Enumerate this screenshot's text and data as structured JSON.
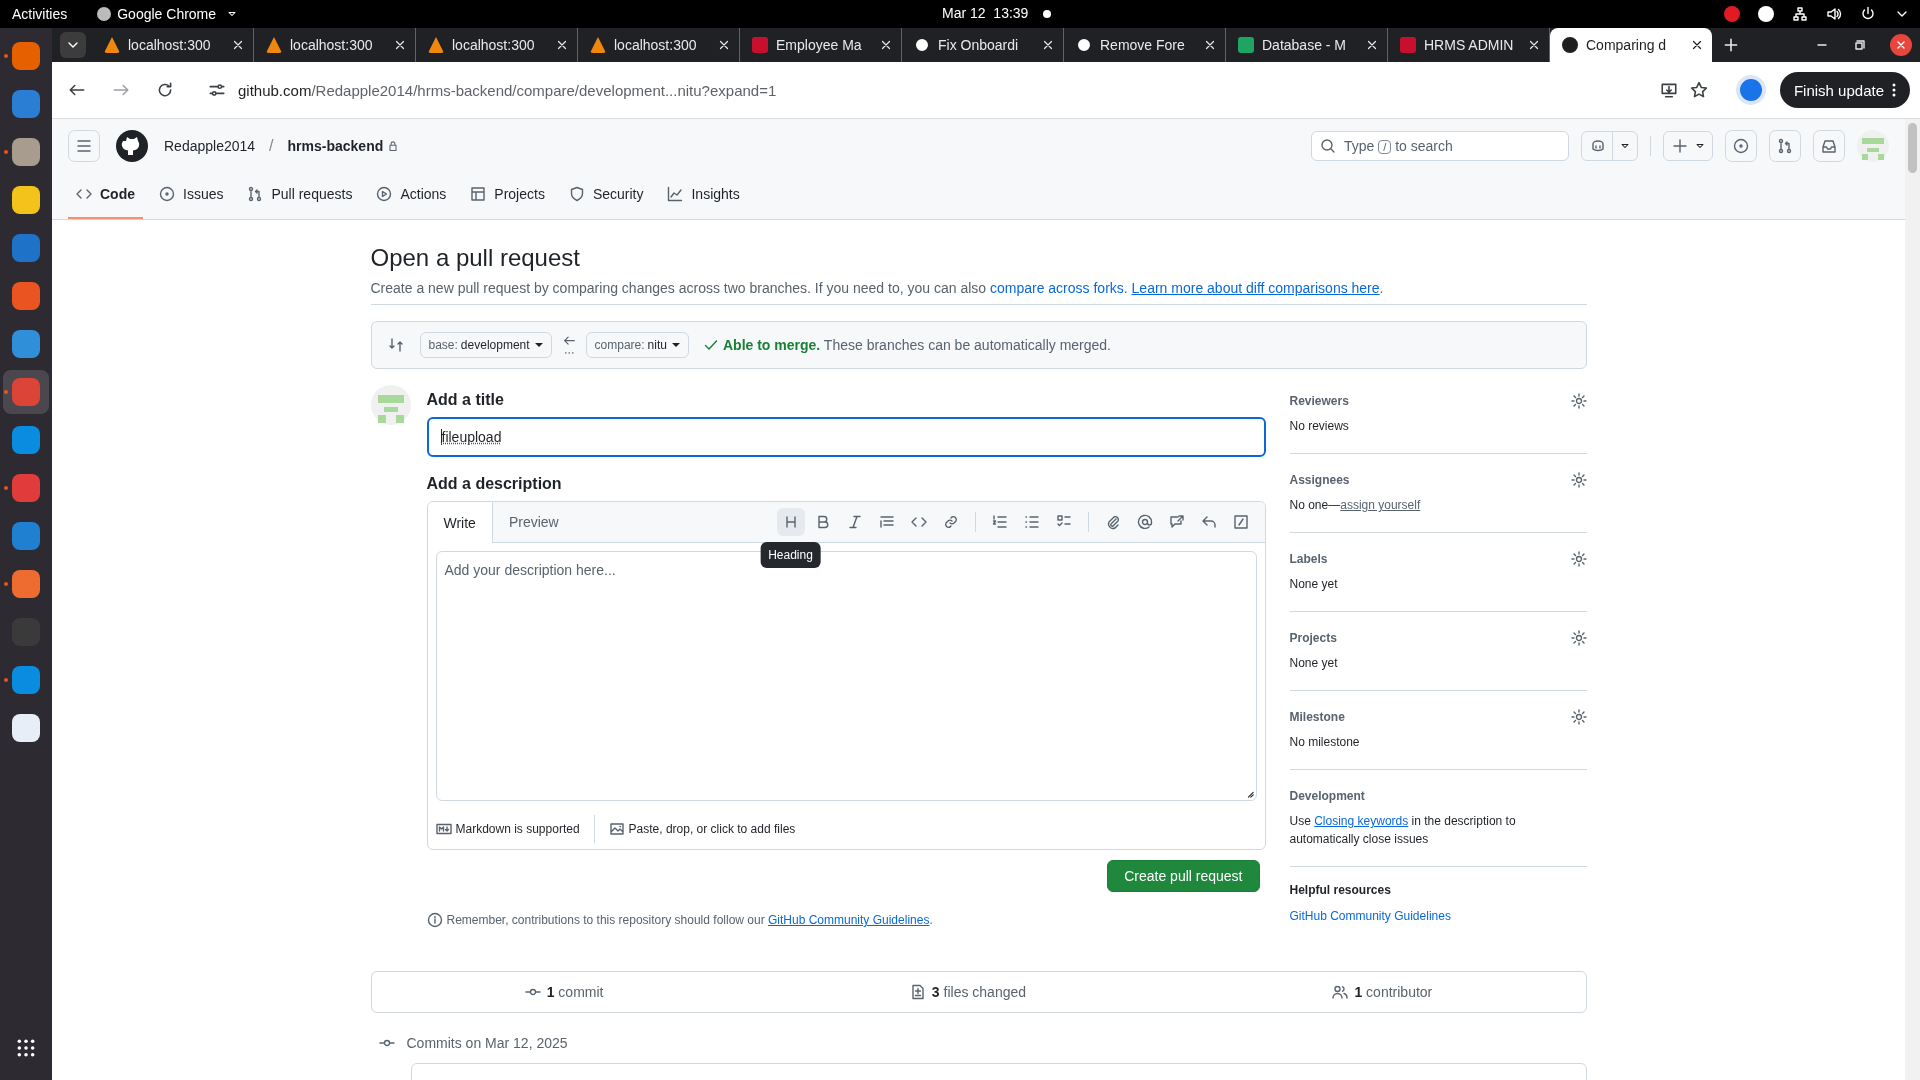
{
  "system_bar": {
    "activities": "Activities",
    "app_name": "Google Chrome",
    "clock": "Mar 12  13:39"
  },
  "dock": [
    {
      "kind": "fox",
      "running": true,
      "selected": false
    },
    {
      "kind": "bird",
      "running": false,
      "selected": false
    },
    {
      "kind": "folder",
      "running": true,
      "selected": false
    },
    {
      "kind": "speaker",
      "running": false,
      "selected": false
    },
    {
      "kind": "document",
      "running": false,
      "selected": false
    },
    {
      "kind": "store",
      "running": false,
      "selected": false
    },
    {
      "kind": "help",
      "running": false,
      "selected": false
    },
    {
      "kind": "wheel",
      "running": true,
      "selected": true
    },
    {
      "kind": "chat",
      "running": false,
      "selected": false
    },
    {
      "kind": "apple",
      "running": true,
      "selected": false
    },
    {
      "kind": "code",
      "running": false,
      "selected": false
    },
    {
      "kind": "rocket",
      "running": true,
      "selected": false
    },
    {
      "kind": "terminal",
      "running": false,
      "selected": false
    },
    {
      "kind": "chat",
      "running": true,
      "selected": false
    },
    {
      "kind": "pencil",
      "running": false,
      "selected": false
    },
    {
      "kind": "grid",
      "running": false,
      "selected": false
    }
  ],
  "browser_tabs": [
    {
      "title": "localhost:300",
      "kind": "triangle",
      "selected": false
    },
    {
      "title": "localhost:300",
      "kind": "triangle",
      "selected": false
    },
    {
      "title": "localhost:300",
      "kind": "triangle",
      "selected": false
    },
    {
      "title": "localhost:300",
      "kind": "triangle",
      "selected": false
    },
    {
      "title": "Employee Ma",
      "kind": "apple",
      "selected": false
    },
    {
      "title": "Fix Onboardi",
      "kind": "cat",
      "selected": false
    },
    {
      "title": "Remove Fore",
      "kind": "cat",
      "selected": false
    },
    {
      "title": "Database - M",
      "kind": "sheet",
      "selected": false
    },
    {
      "title": "HRMS ADMIN",
      "kind": "apple",
      "selected": false
    },
    {
      "title": "Comparing d",
      "kind": "cat",
      "selected": true
    }
  ],
  "address_bar": {
    "host": "github.com",
    "path": "/Redapple2014/hrms-backend/compare/development...nitu?expand=1"
  },
  "update_button": "Finish update",
  "repo_header": {
    "owner": "Redapple2014",
    "separator": "/",
    "repo": "hrms-backend",
    "search": {
      "before": "Type",
      "key": "/",
      "after": "to search"
    }
  },
  "repo_nav": [
    {
      "label": "Code",
      "kind": "code",
      "selected": true
    },
    {
      "label": "Issues",
      "kind": "issue",
      "selected": false
    },
    {
      "label": "Pull requests",
      "kind": "pr",
      "selected": false
    },
    {
      "label": "Actions",
      "kind": "play",
      "selected": false
    },
    {
      "label": "Projects",
      "kind": "table",
      "selected": false
    },
    {
      "label": "Security",
      "kind": "shield",
      "selected": false
    },
    {
      "label": "Insights",
      "kind": "graph",
      "selected": false
    }
  ],
  "page": {
    "title": "Open a pull request",
    "intro": "Create a new pull request by comparing changes across two branches. If you need to, you can also ",
    "intro_link": "compare across forks.",
    "learn_link": "Learn more about diff comparisons here",
    "intro_end": "."
  },
  "compare_bar": {
    "base_label": "base:",
    "base": "development",
    "compare_label": "compare:",
    "compare": "nitu",
    "merge_status": "Able to merge.",
    "merge_note": "These branches can be automatically merged."
  },
  "form": {
    "title_heading": "Add a title",
    "title_value": "fileupload",
    "description_heading": "Add a description",
    "editor_tabs": [
      {
        "label": "Write",
        "selected": true
      },
      {
        "label": "Preview",
        "selected": false
      }
    ],
    "toolbar": [
      {
        "kind": "heading",
        "hovered": true
      },
      {
        "kind": "bold",
        "hovered": false
      },
      {
        "kind": "italic",
        "hovered": false
      },
      {
        "kind": "quote",
        "hovered": false
      },
      {
        "kind": "code",
        "hovered": false
      },
      {
        "kind": "link",
        "hovered": false
      },
      {
        "kind": "sep"
      },
      {
        "kind": "ol",
        "hovered": false
      },
      {
        "kind": "ul",
        "hovered": false
      },
      {
        "kind": "tasks",
        "hovered": false
      },
      {
        "kind": "sep"
      },
      {
        "kind": "clip",
        "hovered": false
      },
      {
        "kind": "mention",
        "hovered": false
      },
      {
        "kind": "crossref",
        "hovered": false
      },
      {
        "kind": "reply",
        "hovered": false
      },
      {
        "kind": "slash",
        "hovered": false
      }
    ],
    "tooltip": "Heading",
    "placeholder": "Add your description here...",
    "markdown_note": "Markdown is supported",
    "files_note": "Paste, drop, or click to add files",
    "submit": "Create pull request",
    "reminder": "Remember, contributions to this repository should follow our ",
    "reminder_link": "GitHub Community Guidelines",
    "reminder_end": "."
  },
  "sidebar": [
    {
      "heading": "Reviewers",
      "value": "No reviews",
      "gear": true
    },
    {
      "heading": "Assignees",
      "value": "No one—",
      "link": "assign yourself",
      "gear": true
    },
    {
      "heading": "Labels",
      "value": "None yet",
      "gear": true
    },
    {
      "heading": "Projects",
      "value": "None yet",
      "gear": true
    },
    {
      "heading": "Milestone",
      "value": "No milestone",
      "gear": true
    },
    {
      "heading": "Development",
      "value": "Use ",
      "link": "Closing keywords",
      "value_end": " in the description to automatically close issues",
      "gear": false
    }
  ],
  "helpful": {
    "heading": "Helpful resources",
    "link": "GitHub Community Guidelines"
  },
  "stats": [
    {
      "kind": "commit",
      "text": "**1** commit"
    },
    {
      "kind": "diff",
      "text": "**3** files changed"
    },
    {
      "kind": "people",
      "text": "**1** contributor"
    }
  ],
  "commits_heading": "Commits on Mar 12, 2025"
}
